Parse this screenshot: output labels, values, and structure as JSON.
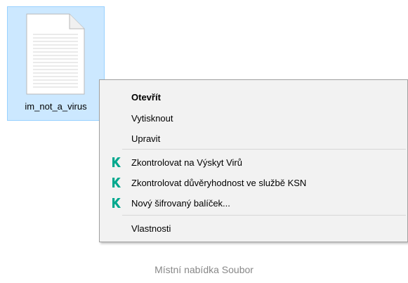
{
  "file": {
    "name": "im_not_a_virus",
    "icon": "text-document-icon"
  },
  "menu": {
    "group1": [
      {
        "label": "Otevřít",
        "bold": true
      },
      {
        "label": "Vytisknout"
      },
      {
        "label": "Upravit"
      }
    ],
    "group2": [
      {
        "label": "Zkontrolovat na Výskyt Virů",
        "icon": "kaspersky-k-icon"
      },
      {
        "label": "Zkontrolovat důvěryhodnost ve službě KSN",
        "icon": "kaspersky-k-icon"
      },
      {
        "label": "Nový šifrovaný balíček...",
        "icon": "kaspersky-k-icon"
      }
    ],
    "group3": [
      {
        "label": "Vlastnosti"
      }
    ]
  },
  "caption": "Místní nabídka Soubor",
  "colors": {
    "selection_bg": "#cce8ff",
    "selection_border": "#99d1ff",
    "menu_bg": "#f2f2f2",
    "kaspersky_green": "#00a88e",
    "caption": "#888888"
  }
}
